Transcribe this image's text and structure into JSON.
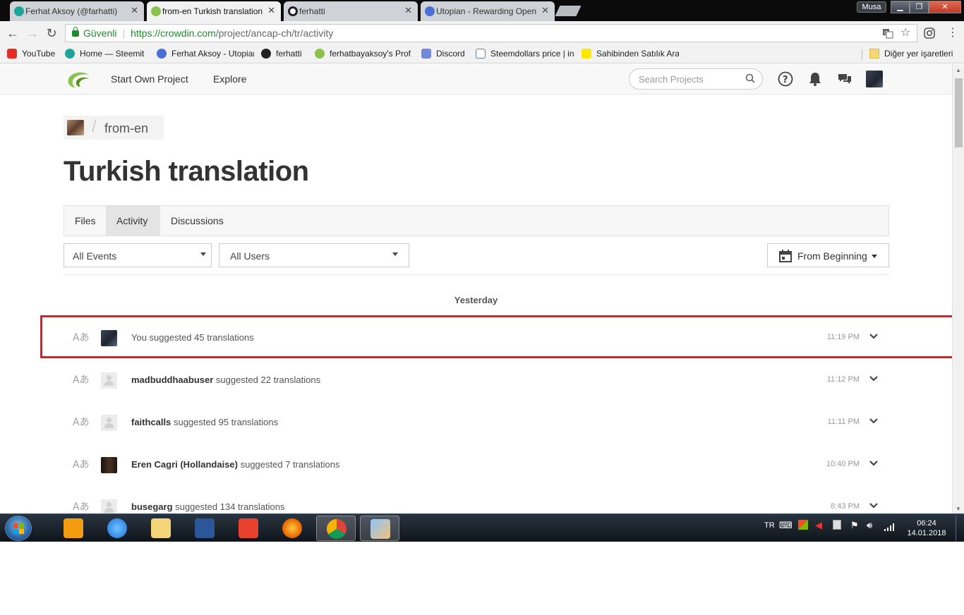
{
  "browser": {
    "tabs": [
      {
        "title": "Ferhat Aksoy (@farhatti)",
        "active": false,
        "color": "#1ea59a"
      },
      {
        "title": "from-en Turkish translation",
        "active": true,
        "color": "#8bc34a"
      },
      {
        "title": "ferhatti",
        "active": false,
        "color": "#222222"
      },
      {
        "title": "Utopian - Rewarding Open Source",
        "active": false,
        "color": "#4a6fd9"
      }
    ],
    "user_badge": "Musa",
    "address": {
      "secure_label": "Güvenli",
      "url_base": "https://crowdin.com",
      "url_path": "/project/ancap-ch/tr/activity"
    },
    "bookmarks": [
      {
        "label": "YouTube",
        "icon": "youtube-icon",
        "color": "#e52d27"
      },
      {
        "label": "Home — Steemit",
        "icon": "steemit-icon",
        "color": "#1ea59a"
      },
      {
        "label": "Ferhat Aksoy - Utopian",
        "icon": "utopian-icon",
        "color": "#4a6fd9"
      },
      {
        "label": "ferhatti",
        "icon": "github-icon",
        "color": "#222222"
      },
      {
        "label": "ferhatbayaksoy's Profile",
        "icon": "crowdin-icon",
        "color": "#8bc34a"
      },
      {
        "label": "Discord",
        "icon": "discord-icon",
        "color": "#7289da"
      },
      {
        "label": "Steemdollars price | in",
        "icon": "coinmarket-icon",
        "color": "#5a7fbf"
      },
      {
        "label": "Sahibinden Satılık Araç",
        "icon": "sahibinden-icon",
        "color": "#ffe800"
      }
    ],
    "other_bookmarks": "Diğer yer işaretleri"
  },
  "header": {
    "nav": [
      "Start Own Project",
      "Explore"
    ],
    "search_placeholder": "Search Projects"
  },
  "breadcrumb": {
    "project": "from-en"
  },
  "page_title": "Turkish translation",
  "tabs": [
    {
      "label": "Files",
      "active": false
    },
    {
      "label": "Activity",
      "active": true
    },
    {
      "label": "Discussions",
      "active": false
    }
  ],
  "filters": {
    "events": "All Events",
    "users": "All Users",
    "date": "From Beginning"
  },
  "day_label": "Yesterday",
  "activities": [
    {
      "user": "",
      "prefix": "You",
      "action": " suggested 45 translations",
      "time": "11:19 PM",
      "avatar": "me",
      "highlighted": true
    },
    {
      "user": "madbuddhaabuser",
      "prefix": "",
      "action": " suggested 22 translations",
      "time": "11:12 PM",
      "avatar": "blank",
      "highlighted": false
    },
    {
      "user": "faithcalls",
      "prefix": "",
      "action": " suggested 95 translations",
      "time": "11:11 PM",
      "avatar": "blank",
      "highlighted": false
    },
    {
      "user": "Eren Cagri (Hollandaise)",
      "prefix": "",
      "action": " suggested 7 translations",
      "time": "10:40 PM",
      "avatar": "eren",
      "highlighted": false
    },
    {
      "user": "busegarg",
      "prefix": "",
      "action": " suggested 134 translations",
      "time": "8:43 PM",
      "avatar": "blank",
      "highlighted": false
    }
  ],
  "taskbar": {
    "apps": [
      "media-player-icon",
      "internet-explorer-icon",
      "file-explorer-icon",
      "word-icon",
      "photo-app-icon",
      "firefox-icon",
      "chrome-icon",
      "paint-icon"
    ],
    "lang": "TR",
    "time": "06:24",
    "date": "14.01.2018"
  }
}
